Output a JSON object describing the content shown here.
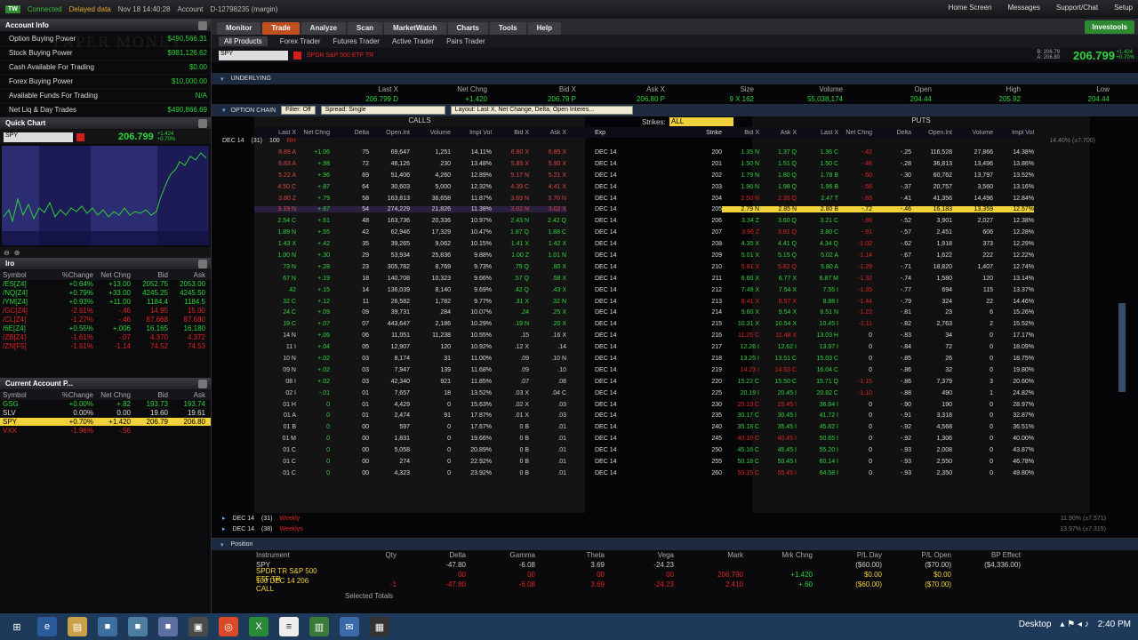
{
  "top": {
    "logo": "TW",
    "connected": "Connected",
    "delayed": "Delayed data",
    "date": "Nov 18 14:40:28",
    "account_label": "Account",
    "account": "D-12798235 (margin)",
    "links": [
      "Home Screen",
      "Messages",
      "Support/Chat",
      "Setup"
    ]
  },
  "account_info": {
    "title": "Account Info",
    "rows": [
      {
        "label": "Option Buying Power",
        "value": "$490,566.31"
      },
      {
        "label": "Stock Buying Power",
        "value": "$981,126.62"
      },
      {
        "label": "Cash Available For Trading",
        "value": "$0.00"
      },
      {
        "label": "Forex Buying Power",
        "value": "$10,000.00"
      },
      {
        "label": "Available Funds For Trading",
        "value": "N/A"
      },
      {
        "label": "Net Liq & Day Trades",
        "value": "$490,866.69"
      }
    ],
    "watermark": "PAPER MONEY"
  },
  "quick_chart": {
    "title": "Quick Chart",
    "symbol": "SPY",
    "price": "206.799",
    "chg1": "+1.424",
    "chg2": "+0.70%"
  },
  "watchlist": {
    "title": "Iro",
    "headers": [
      "Symbol",
      "%Change",
      "Net Chng",
      "Bid",
      "Ask"
    ],
    "rows": [
      {
        "s": "/ES[Z4]",
        "p": "+0.64%",
        "n": "+13.00",
        "b": "2052.75",
        "a": "2053.00",
        "c": "g"
      },
      {
        "s": "/NQ[Z4]",
        "p": "+0.79%",
        "n": "+33.00",
        "b": "4245.25",
        "a": "4245.50",
        "c": "g"
      },
      {
        "s": "/YM[Z4]",
        "p": "+0.93%",
        "n": "+11.00",
        "b": "1184.4",
        "a": "1184.5",
        "c": "g"
      },
      {
        "s": "/GC[Z4]",
        "p": "-2.61%",
        "n": "-.46",
        "b": "14.95",
        "a": "15.00",
        "c": "r"
      },
      {
        "s": "/CL[Z4]",
        "p": "-1.27%",
        "n": "-.46",
        "b": "87.668",
        "a": "87.680",
        "c": "r"
      },
      {
        "s": "/6E[Z4]",
        "p": "+0.55%",
        "n": "+.006",
        "b": "16.165",
        "a": "16.180",
        "c": "g"
      },
      {
        "s": "/ZB[Z4]",
        "p": "-1.61%",
        "n": "-.07",
        "b": "4.370",
        "a": "4.372",
        "c": "r"
      },
      {
        "s": "/ZN[F5]",
        "p": "-1.61%",
        "n": "-1.14",
        "b": "74.52",
        "a": "74.53",
        "c": "r"
      }
    ]
  },
  "current_account": {
    "title": "Current Account P...",
    "headers": [
      "Symbol",
      "%Change",
      "Net Chng",
      "Bid",
      "Ask"
    ],
    "rows": [
      {
        "s": "GSG",
        "p": "+0.00%",
        "n": "+.82",
        "b": "193.73",
        "a": "193.74",
        "c": "g"
      },
      {
        "s": "SLV",
        "p": "0.00%",
        "n": "0.00",
        "b": "19.60",
        "a": "19.61",
        "c": "w"
      },
      {
        "s": "SPY",
        "p": "+0.70%",
        "n": "+1.420",
        "b": "206.79",
        "a": "206.80",
        "c": "hl"
      },
      {
        "s": "VXX",
        "p": "-1.96%",
        "n": "-.56",
        "b": "",
        "a": "",
        "c": "r"
      }
    ]
  },
  "tabs": [
    "Monitor",
    "Trade",
    "Analyze",
    "Scan",
    "MarketWatch",
    "Charts",
    "Tools",
    "Help"
  ],
  "active_tab": "Trade",
  "invest_btn": "Investools",
  "subtabs": [
    "All Products",
    "Forex Trader",
    "Futures Trader",
    "Active Trader",
    "Pairs Trader"
  ],
  "symbol": {
    "value": "SPY",
    "desc": "SPDR S&P 500 ETF TR",
    "price": "206.799",
    "bid": "B:  206.79",
    "ask": "A:  206.80",
    "net": "+1.424",
    "pct": "+0.70%"
  },
  "underlying": {
    "label": "UNDERLYING",
    "headers": [
      "Last X",
      "Net Chng",
      "Bid X",
      "Ask X",
      "Size",
      "Volume",
      "Open",
      "High",
      "Low"
    ],
    "values": [
      "206.799 D",
      "+1.420",
      "206.79 P",
      "206.80 P",
      "9 X 162",
      "55,038,174",
      "204.44",
      "205.92",
      "204.44"
    ]
  },
  "option_chain": {
    "label": "OPTION CHAIN",
    "filter": "Filter: Off",
    "spread": "Spread: Single",
    "layout": "Layout: Last X, Net Change, Delta, Open Interes...",
    "strikes_label": "Strikes:",
    "strikes_val": "ALL",
    "calls": "CALLS",
    "puts": "PUTS",
    "call_headers": [
      "Last X",
      "Net Chng",
      "Delta",
      "Open.Int",
      "Volume",
      "Impl Vol",
      "Bid X",
      "Ask X"
    ],
    "mid_headers": [
      "Exp",
      "Strike"
    ],
    "put_headers": [
      "Bid X",
      "Ask X",
      "Last X",
      "Net Chng",
      "Delta",
      "Open.Int",
      "Volume",
      "Impl Vol"
    ],
    "series_header": {
      "exp": "DEC 14",
      "days": "(31)",
      "mult": "100",
      "tag": "RH",
      "iv": "14.40% (±7.700)"
    },
    "rows": [
      [
        "8.89 A",
        "+1.06",
        "75",
        "69,647",
        "1,251",
        "14.11%",
        "6.80 X",
        "6.85 X",
        "DEC 14",
        "200",
        "1.35 N",
        "1.37 Q",
        "1.36 C",
        "-.42",
        "-.25",
        "116,528",
        "27,866",
        "14.38%"
      ],
      [
        "6.83 A",
        "+.98",
        "72",
        "46,126",
        "230",
        "13.48%",
        "5.85 X",
        "5.90 X",
        "DEC 14",
        "201",
        "1.50 N",
        "1.51 Q",
        "1.50 C",
        "-.46",
        "-.28",
        "36,813",
        "13,496",
        "13.86%"
      ],
      [
        "5.22 A",
        "+.96",
        "69",
        "51,406",
        "4,260",
        "12.89%",
        "5.17 N",
        "5.21 X",
        "DEC 14",
        "202",
        "1.79 N",
        "1.80 Q",
        "1.78 B",
        "-.50",
        "-.30",
        "60,762",
        "13,797",
        "13.52%"
      ],
      [
        "4.50 C",
        "+.87",
        "64",
        "30,603",
        "5,000",
        "12.32%",
        "4.39 C",
        "4.41 X",
        "DEC 14",
        "203",
        "1.96 N",
        "1.98 Q",
        "1.96 B",
        "-.56",
        "-.37",
        "20,757",
        "3,560",
        "13.16%"
      ],
      [
        "3.80 Z",
        "+.79",
        "58",
        "163,813",
        "36,658",
        "11.87%",
        "3.69 N",
        "3.70 N",
        "DEC 14",
        "204",
        "2.50 N",
        "2.35 Q",
        "2.47 T",
        "-.65",
        "-.41",
        "41,356",
        "14,496",
        "12.84%"
      ],
      [
        "3.19 N",
        "+.67",
        "54",
        "274,229",
        "21,826",
        "11.38%",
        "3.02 N",
        "3.02 X",
        "DEC 14",
        "205",
        "2.79 N",
        "2.85 N",
        "2.80 B",
        "-.72",
        "-.46",
        "16,183",
        "13,359",
        "12.57%"
      ],
      [
        "2.54 C",
        "+.61",
        "48",
        "163,736",
        "20,336",
        "10.97%",
        "2.43 N",
        "2.42 Q",
        "DEC 14",
        "206",
        "3.34 Z",
        "3.60 Q",
        "3.21 C",
        "-.86",
        "-.52",
        "3,901",
        "2,027",
        "12.38%"
      ],
      [
        "1.89 N",
        "+.55",
        "42",
        "62,946",
        "17,329",
        "10.47%",
        "1.87 Q",
        "1.88 C",
        "DEC 14",
        "207",
        "3.96 Z",
        "3.81 Q",
        "3.80 C",
        "-.91",
        "-.57",
        "2,451",
        "606",
        "12.28%"
      ],
      [
        "1.43 X",
        "+.42",
        "35",
        "39,265",
        "9,062",
        "10.15%",
        "1.41 X",
        "1.42 X",
        "DEC 14",
        "208",
        "4.35 X",
        "4.41 Q",
        "4.34 Q",
        "-1.02",
        "-.62",
        "1,918",
        "373",
        "12.29%"
      ],
      [
        "1.00 N",
        "+.30",
        "29",
        "53,934",
        "25,836",
        "9.88%",
        "1.00 Z",
        "1.01 N",
        "DEC 14",
        "209",
        "5.01 X",
        "5.15 Q",
        "5.02 A",
        "-1.14",
        "-.67",
        "1,622",
        "222",
        "12.22%"
      ],
      [
        "73 N",
        "+.28",
        "23",
        "305,782",
        "8,769",
        "9.73%",
        ".79 Q",
        ".80 X",
        "DEC 14",
        "210",
        "5.81 X",
        "5.82 Q",
        "5.80 A",
        "-1.29",
        "-.71",
        "18,820",
        "1,407",
        "12.74%"
      ],
      [
        "67 N",
        "+.19",
        "18",
        "140,708",
        "10,323",
        "9.66%",
        ".57 Q",
        ".58 X",
        "DEC 14",
        "211",
        "6.60 X",
        "6.77 X",
        "6.87 M",
        "-1.32",
        "-.74",
        "1,580",
        "120",
        "13.14%"
      ],
      [
        "42",
        "+.15",
        "14",
        "136,039",
        "8,140",
        "9.69%",
        ".42 Q",
        ".43 X",
        "DEC 14",
        "212",
        "7.49 X",
        "7.54 X",
        "7.55 I",
        "-1.35",
        "-.77",
        "694",
        "115",
        "13.37%"
      ],
      [
        "32 C",
        "+.12",
        "11",
        "26,582",
        "1,782",
        "9.77%",
        ".31 X",
        ".32 N",
        "DEC 14",
        "213",
        "8.41 X",
        "8.57 X",
        "8.88 I",
        "-1.44",
        "-.79",
        "324",
        "22",
        "14.46%"
      ],
      [
        "24 C",
        "+.09",
        "09",
        "39,731",
        "284",
        "10.07%",
        ".24",
        ".25 X",
        "DEC 14",
        "214",
        "9.60 X",
        "9.54 X",
        "8.51 N",
        "-1.22",
        "-.81",
        "23",
        "6",
        "15.26%"
      ],
      [
        "19 C",
        "+.07",
        "07",
        "443,647",
        "2,186",
        "10.29%",
        ".19 N",
        ".20 X",
        "DEC 14",
        "215",
        "10.31 X",
        "10.54 X",
        "10.45 I",
        "-1.11",
        "-.82",
        "2,763",
        "2",
        "15.52%"
      ],
      [
        "14 N",
        "+.06",
        "06",
        "11,051",
        "11,238",
        "10.55%",
        ".15",
        ".16 X",
        "DEC 14",
        "216",
        "11.26 C",
        "11.48 X",
        "13.03 H",
        "0",
        "-.83",
        "34",
        "0",
        "17.17%"
      ],
      [
        "11 I",
        "+.04",
        "05",
        "12,907",
        "120",
        "10.92%",
        ".12 X",
        ".14",
        "DEC 14",
        "217",
        "12.26 I",
        "12.62 I",
        "13.97 I",
        "0",
        "-.84",
        "72",
        "0",
        "18.09%"
      ],
      [
        "10 N",
        "+.02",
        "03",
        "8,174",
        "31",
        "11.00%",
        ".09",
        ".10 N",
        "DEC 14",
        "218",
        "13.25 I",
        "13.51 C",
        "15.03 C",
        "0",
        "-.85",
        "26",
        "0",
        "18.75%"
      ],
      [
        "09 N",
        "+.02",
        "03",
        "7,947",
        "139",
        "11.68%",
        ".09",
        ".10",
        "DEC 14",
        "219",
        "14.23 I",
        "14.53 C",
        "16.04 C",
        "0",
        "-.86",
        "32",
        "0",
        "19.80%"
      ],
      [
        "08 I",
        "+.02",
        "03",
        "42,340",
        "921",
        "11.85%",
        ".07",
        ".08",
        "DEC 14",
        "220",
        "15.22 C",
        "15.50 C",
        "15.71 Q",
        "-1.15",
        "-.86",
        "7,379",
        "3",
        "20.60%"
      ],
      [
        "02 I",
        "-.01",
        "01",
        "7,657",
        "18",
        "13.52%",
        ".03 X",
        ".04 C",
        "DEC 14",
        "225",
        "20.19 I",
        "20.45 I",
        "20.82 C",
        "-1.10",
        "-.88",
        "490",
        "1",
        "24.82%"
      ],
      [
        "01 H",
        "0",
        "01",
        "4,429",
        "0",
        "15.63%",
        ".02 X",
        ".03",
        "DEC 14",
        "230",
        "25.19 C",
        "25.45 I",
        "36.84 I",
        "0",
        "-.90",
        "190",
        "0",
        "28.97%"
      ],
      [
        "01 A",
        "0",
        "01",
        "2,474",
        "91",
        "17.87%",
        ".01 X",
        ".03",
        "DEC 14",
        "235",
        "30.17 C",
        "30.45 I",
        "41.72 I",
        "0",
        "-.91",
        "3,318",
        "0",
        "32.87%"
      ],
      [
        "01 B",
        "0",
        "00",
        "597",
        "0",
        "17.67%",
        "0 B",
        ".01",
        "DEC 14",
        "240",
        "35.18 C",
        "35.45 I",
        "45.82 I",
        "0",
        "-.92",
        "4,568",
        "0",
        "36.51%"
      ],
      [
        "01 M",
        "0",
        "00",
        "1,831",
        "0",
        "19.66%",
        "0 B",
        ".01",
        "DEC 14",
        "245",
        "40.16 C",
        "40.45 I",
        "50.65 I",
        "0",
        "-.92",
        "1,306",
        "0",
        "40.00%"
      ],
      [
        "01 C",
        "0",
        "00",
        "5,058",
        "0",
        "20.89%",
        "0 B",
        ".01",
        "DEC 14",
        "250",
        "45.16 C",
        "45.45 I",
        "55.20 I",
        "0",
        "-.93",
        "2,008",
        "0",
        "43.87%"
      ],
      [
        "01 C",
        "0",
        "00",
        "274",
        "0",
        "22.92%",
        "0 B",
        ".01",
        "DEC 14",
        "255",
        "50.18 C",
        "50.45 I",
        "60.14 I",
        "0",
        "-.93",
        "2,550",
        "0",
        "46.78%"
      ],
      [
        "01 C",
        "0",
        "00",
        "4,323",
        "0",
        "23.92%",
        "0 B",
        ".01",
        "DEC 14",
        "260",
        "55.15 C",
        "55.45 I",
        "64.58 I",
        "0",
        "-.93",
        "2,350",
        "0",
        "49.80%"
      ]
    ],
    "highlight_row": 5,
    "more_series": [
      {
        "exp": "DEC 14",
        "days": "(31)",
        "tag": "Weekly",
        "iv": "11.90% (±7.571)"
      },
      {
        "exp": "DEC 14",
        "days": "(38)",
        "tag": "Weeklys",
        "iv": "13.97% (±7.315)"
      }
    ]
  },
  "position": {
    "label": "Position",
    "headers": [
      "Instrument",
      "Qty",
      "Delta",
      "Gamma",
      "Theta",
      "Vega",
      "Mark",
      "Mrk Chng",
      "P/L Day",
      "P/L Open",
      "BP Effect"
    ],
    "rows": [
      [
        "SPY",
        "",
        "-47.80",
        "-6.08",
        "3.69",
        "-24.23",
        "",
        "",
        "($60.00)",
        "($70.00)",
        "($4,336.00)"
      ],
      [
        "SPDR TR S&P 500 ETF TR",
        "",
        "00",
        "00",
        "00",
        "00",
        "206.790",
        "+1.420",
        "$0.00",
        "$0.00",
        ""
      ],
      [
        "100 DEC 14 206 CALL",
        "-1",
        "-47.80",
        "-6.08",
        "3.69",
        "-24.23",
        "2.410",
        "+.60",
        "($60.00)",
        "($70.00)",
        ""
      ]
    ],
    "footer": "Selected Totals"
  },
  "taskbar": {
    "desktop": "Desktop",
    "time": "2:40 PM"
  }
}
